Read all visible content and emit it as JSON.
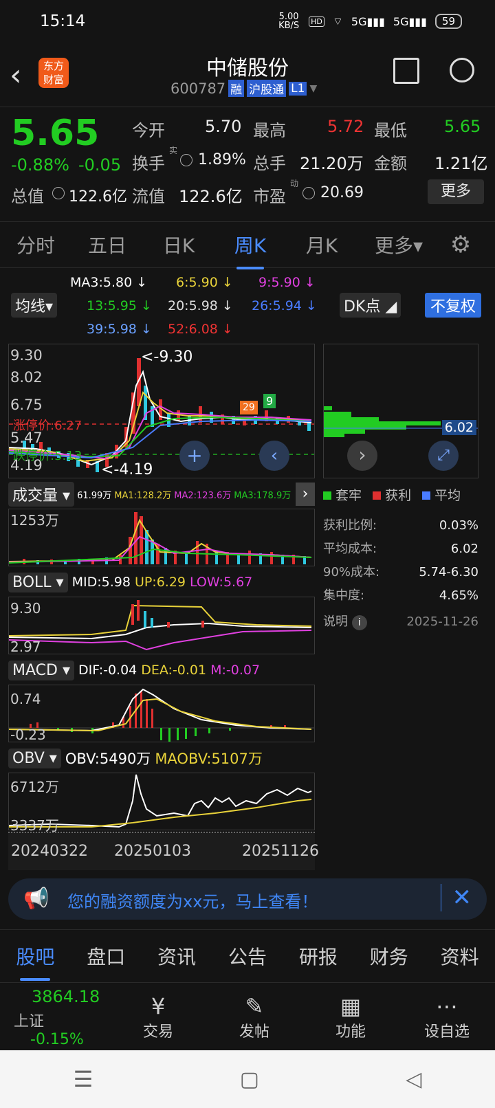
{
  "status": {
    "time": "15:14",
    "net": "5.00 KB/S",
    "battery": "59"
  },
  "header": {
    "logo_line1": "东方",
    "logo_line2": "财富",
    "title": "中储股份",
    "code": "600787",
    "tag_rong": "融",
    "tag_hgt": "沪股通",
    "tag_l1": "L1"
  },
  "quote": {
    "price": "5.65",
    "change_pct": "-0.88%",
    "change": "-0.05",
    "open_label": "今开",
    "open": "5.70",
    "high_label": "最高",
    "high": "5.72",
    "low_label": "最低",
    "low": "5.65",
    "turnover_label": "换手",
    "turnover_sup": "实",
    "turnover": "1.89%",
    "volume_label": "总手",
    "volume": "21.20万",
    "amount_label": "金额",
    "amount": "1.21亿",
    "mktcap_label": "总值",
    "mktcap": "122.6亿",
    "float_label": "流值",
    "float": "122.6亿",
    "pe_label": "市盈",
    "pe_sup": "动",
    "pe": "20.69",
    "more": "更多"
  },
  "tabs": [
    "分时",
    "五日",
    "日K",
    "周K",
    "月K",
    "更多▾"
  ],
  "ma": {
    "ma3": "MA3:5.80 ↓",
    "ma6": "6:5.90 ↓",
    "ma9": "9:5.90 ↓",
    "ma13": "13:5.95 ↓",
    "ma20": "20:5.98 ↓",
    "ma26": "26:5.94 ↓",
    "ma39": "39:5.98 ↓",
    "ma52": "52:6.08 ↓",
    "selector": "均线",
    "dk": "DK点",
    "fq": "不复权"
  },
  "kline": {
    "y1": "9.30",
    "y2": "8.02",
    "y3": "6.75",
    "y4": "5.47",
    "y5": "4.19",
    "max_label": "<-9.30",
    "min_label": "<-4.19",
    "limit_up": "涨停价:6.27",
    "limit_down": "跌停价:5.13",
    "badge_orange": "29",
    "badge_green": "9"
  },
  "chips": {
    "current": "6.02",
    "legend": [
      "套牢",
      "获利",
      "平均"
    ],
    "profit_label": "获利比例:",
    "profit": "0.03%",
    "avg_label": "平均成本:",
    "avg": "6.02",
    "c90_label": "90%成本:",
    "c90": "5.74-6.30",
    "conc_label": "集中度:",
    "conc": "4.65%",
    "note": "说明",
    "date": "2025-11-26"
  },
  "vol": {
    "selector": "成交量",
    "v": "61.99万",
    "ma1": "MA1:128.2万",
    "ma2": "MA2:123.6万",
    "ma3": "MA3:178.9万",
    "ytop": "1253万"
  },
  "boll": {
    "selector": "BOLL",
    "mid": "MID:5.98",
    "up": "UP:6.29",
    "low": "LOW:5.67",
    "ytop": "9.30",
    "ybot": "2.97"
  },
  "macd": {
    "selector": "MACD",
    "dif": "DIF:-0.04",
    "dea": "DEA:-0.01",
    "m": "M:-0.07",
    "ytop": "0.74",
    "ybot": "-0.23"
  },
  "obv": {
    "selector": "OBV",
    "obv": "OBV:5490万",
    "maobv": "MAOBV:5107万",
    "ytop": "6712万",
    "ybot": "3337万"
  },
  "dates": [
    "20240322",
    "20250103",
    "20251126"
  ],
  "banner": {
    "text": "您的融资额度为xx元，马上查看！"
  },
  "bottomtabs": [
    "股吧",
    "盘口",
    "资讯",
    "公告",
    "研报",
    "财务",
    "资料"
  ],
  "index": {
    "value": "3864.18",
    "name": "上证",
    "change": "-0.15%"
  },
  "tools": [
    "交易",
    "发帖",
    "功能",
    "设自选"
  ]
}
